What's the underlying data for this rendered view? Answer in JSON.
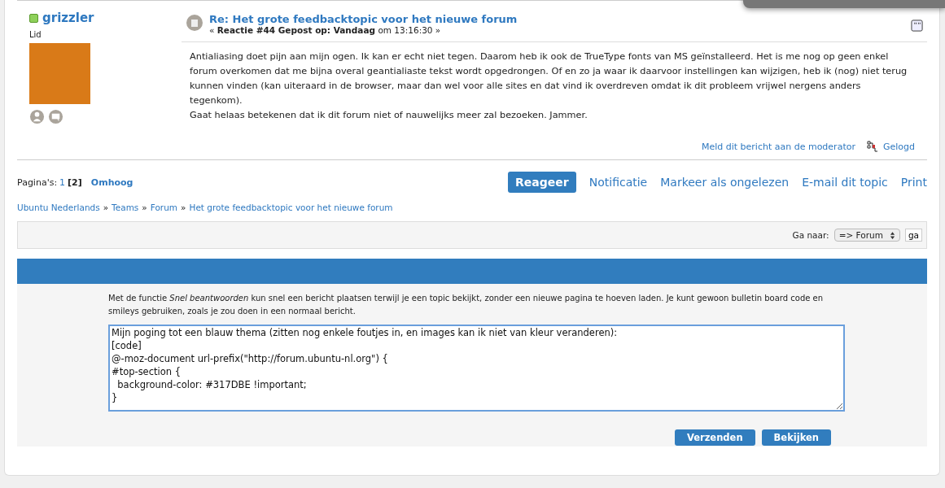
{
  "post": {
    "author": {
      "name": "grizzler",
      "online": true,
      "rank": "Lid"
    },
    "title": "Re: Het grote feedbacktopic voor het nieuwe forum",
    "meta": "« **Reactie #44 Gepost op: Vandaag** om 13:16:30 »",
    "body": [
      "Antialiasing doet pijn aan mijn ogen. Ik kan er echt niet tegen. Daarom heb ik ook de TrueType fonts van MS geïnstalleerd. Het is me nog op geen enkel forum overkomen dat me bijna overal geantialiaste tekst wordt opgedrongen. Of en zo ja waar ik daarvoor instellingen kan wijzigen, heb ik (nog) niet terug kunnen vinden (kan uiteraard in de browser, maar dan wel voor alle sites en dat vind ik overdreven omdat ik dit probleem vrijwel nergens anders tegenkom).",
      "Gaat helaas betekenen dat ik dit forum niet of nauwelijks meer zal bezoeken. Jammer."
    ],
    "report_link": "Meld dit bericht aan de moderator",
    "logged": "Gelogd"
  },
  "pagination": {
    "label": "Pagina's:",
    "pages": [
      {
        "label": "1",
        "selected": false
      },
      {
        "label": "[2]",
        "selected": true
      }
    ],
    "top_link": "Omhoog"
  },
  "actions": [
    {
      "label": "Reageer",
      "primary": true
    },
    {
      "label": "Notificatie",
      "primary": false
    },
    {
      "label": "Markeer als ongelezen",
      "primary": false
    },
    {
      "label": "E-mail dit topic",
      "primary": false
    },
    {
      "label": "Print",
      "primary": false
    }
  ],
  "breadcrumb": {
    "separator": "»",
    "items": [
      "Ubuntu Nederlands",
      "Teams",
      "Forum",
      "Het grote feedbacktopic voor het nieuwe forum"
    ]
  },
  "jump": {
    "label": "Ga naar:",
    "value": "=> Forum",
    "button": "ga"
  },
  "quick_reply": {
    "intro": "Met de functie *Snel beantwoorden* kun snel een bericht plaatsen terwijl je een topic bekijkt, zonder een nieuwe pagina te hoeven laden. Je kunt gewoon bulletin board code en smileys gebruiken, zoals je zou doen in een normaal bericht.",
    "value": "Mijn poging tot een blauw thema (zitten nog enkele foutjes in, en images kan ik niet van kleur veranderen):\n[code]\n@-moz-document url-prefix(\"http://forum.ubuntu-nl.org\") {\n#top-section {\n  background-color: #317DBE !important;\n}",
    "buttons": [
      "Verzenden",
      "Bekijken"
    ]
  }
}
